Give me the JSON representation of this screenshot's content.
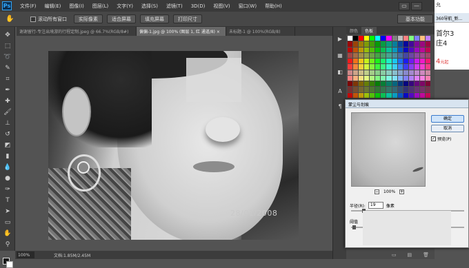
{
  "app": {
    "logo": "Ps"
  },
  "menu": [
    "文件(F)",
    "编辑(E)",
    "图像(I)",
    "图层(L)",
    "文字(Y)",
    "选择(S)",
    "滤镜(T)",
    "3D(D)",
    "视图(V)",
    "窗口(W)",
    "帮助(H)"
  ],
  "window_controls": [
    "▭",
    "—"
  ],
  "options": {
    "scroll_all_label": "滚动所有窗口",
    "buttons": [
      "实际像素",
      "适合屏幕",
      "填充屏幕",
      "打印尺寸"
    ],
    "workspace": "基本功能"
  },
  "doc_tabs": [
    "谢谢留行-专注出境游的行程定制.jpeg @ 66.7%(RGB/8#)",
    "偏偏-1.jpg @ 100% (图层 1, 红 通道/8) ×",
    "未标题-1 @ 100%(RGB/8)"
  ],
  "photo": {
    "date_stamp": "28/01/2008"
  },
  "status": {
    "zoom": "100%",
    "doc_info": "文档:1.85M/2.45M"
  },
  "panel": {
    "tabs": [
      "颜色",
      "色板"
    ]
  },
  "swatch_colors": [
    "#ffffff",
    "#000000",
    "#ff0000",
    "#ffff00",
    "#00ff00",
    "#00ffff",
    "#0000ff",
    "#ff00ff",
    "#808080",
    "#c0c0c0",
    "#ff8080",
    "#80ff80",
    "#8080ff",
    "#ffc080",
    "#c080ff"
  ],
  "dialog": {
    "title": "蒙尘与划痕",
    "ok": "确定",
    "reset": "取消",
    "preview_label": "预览(P)",
    "zoom": "100%",
    "radius_label": "半径(R):",
    "radius_value": "19",
    "radius_unit": "像素",
    "threshold_label": "阈值"
  },
  "browser": {
    "top_text": "允",
    "tab": "360导航_新...",
    "line1": "首尔3",
    "line2": "庄4",
    "price": "4",
    "price_unit": "元起"
  }
}
